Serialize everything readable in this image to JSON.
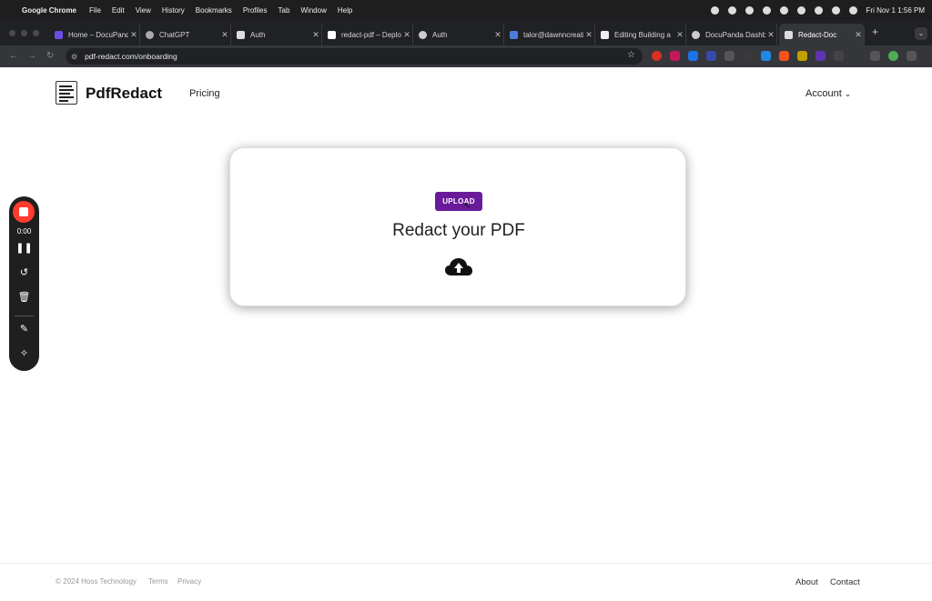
{
  "menubar": {
    "app_name": "Google Chrome",
    "menus": [
      "File",
      "Edit",
      "View",
      "History",
      "Bookmarks",
      "Profiles",
      "Tab",
      "Window",
      "Help"
    ],
    "clock": "Fri Nov 1  1:56 PM"
  },
  "tabs": [
    {
      "title": "Home – DocuPanda",
      "icon": "docupanda-icon"
    },
    {
      "title": "ChatGPT",
      "icon": "chatgpt-icon"
    },
    {
      "title": "Auth",
      "icon": "doc-icon"
    },
    {
      "title": "redact-pdf – Deploy",
      "icon": "vercel-icon"
    },
    {
      "title": "Auth",
      "icon": "panda-icon"
    },
    {
      "title": "talor@dawnncreative",
      "icon": "mail-icon"
    },
    {
      "title": "Editing Building a",
      "icon": "medium-icon"
    },
    {
      "title": "DocuPanda Dashboard",
      "icon": "panda-icon"
    },
    {
      "title": "Redact-Doc",
      "icon": "doc-icon"
    }
  ],
  "address_bar": {
    "url": "pdf-redact.com/onboarding"
  },
  "header": {
    "brand": "PdfRedact",
    "nav_pricing": "Pricing",
    "account": "Account"
  },
  "card": {
    "upload_label": "UPLOAD",
    "title": "Redact your PDF"
  },
  "recorder": {
    "time": "0:00"
  },
  "footer": {
    "copyright": "© 2024 Hoss Technology",
    "terms": "Terms",
    "privacy": "Privacy",
    "about": "About",
    "contact": "Contact"
  },
  "colors": {
    "upload_button": "#6a1b9a",
    "record_stop": "#ff3b30"
  }
}
